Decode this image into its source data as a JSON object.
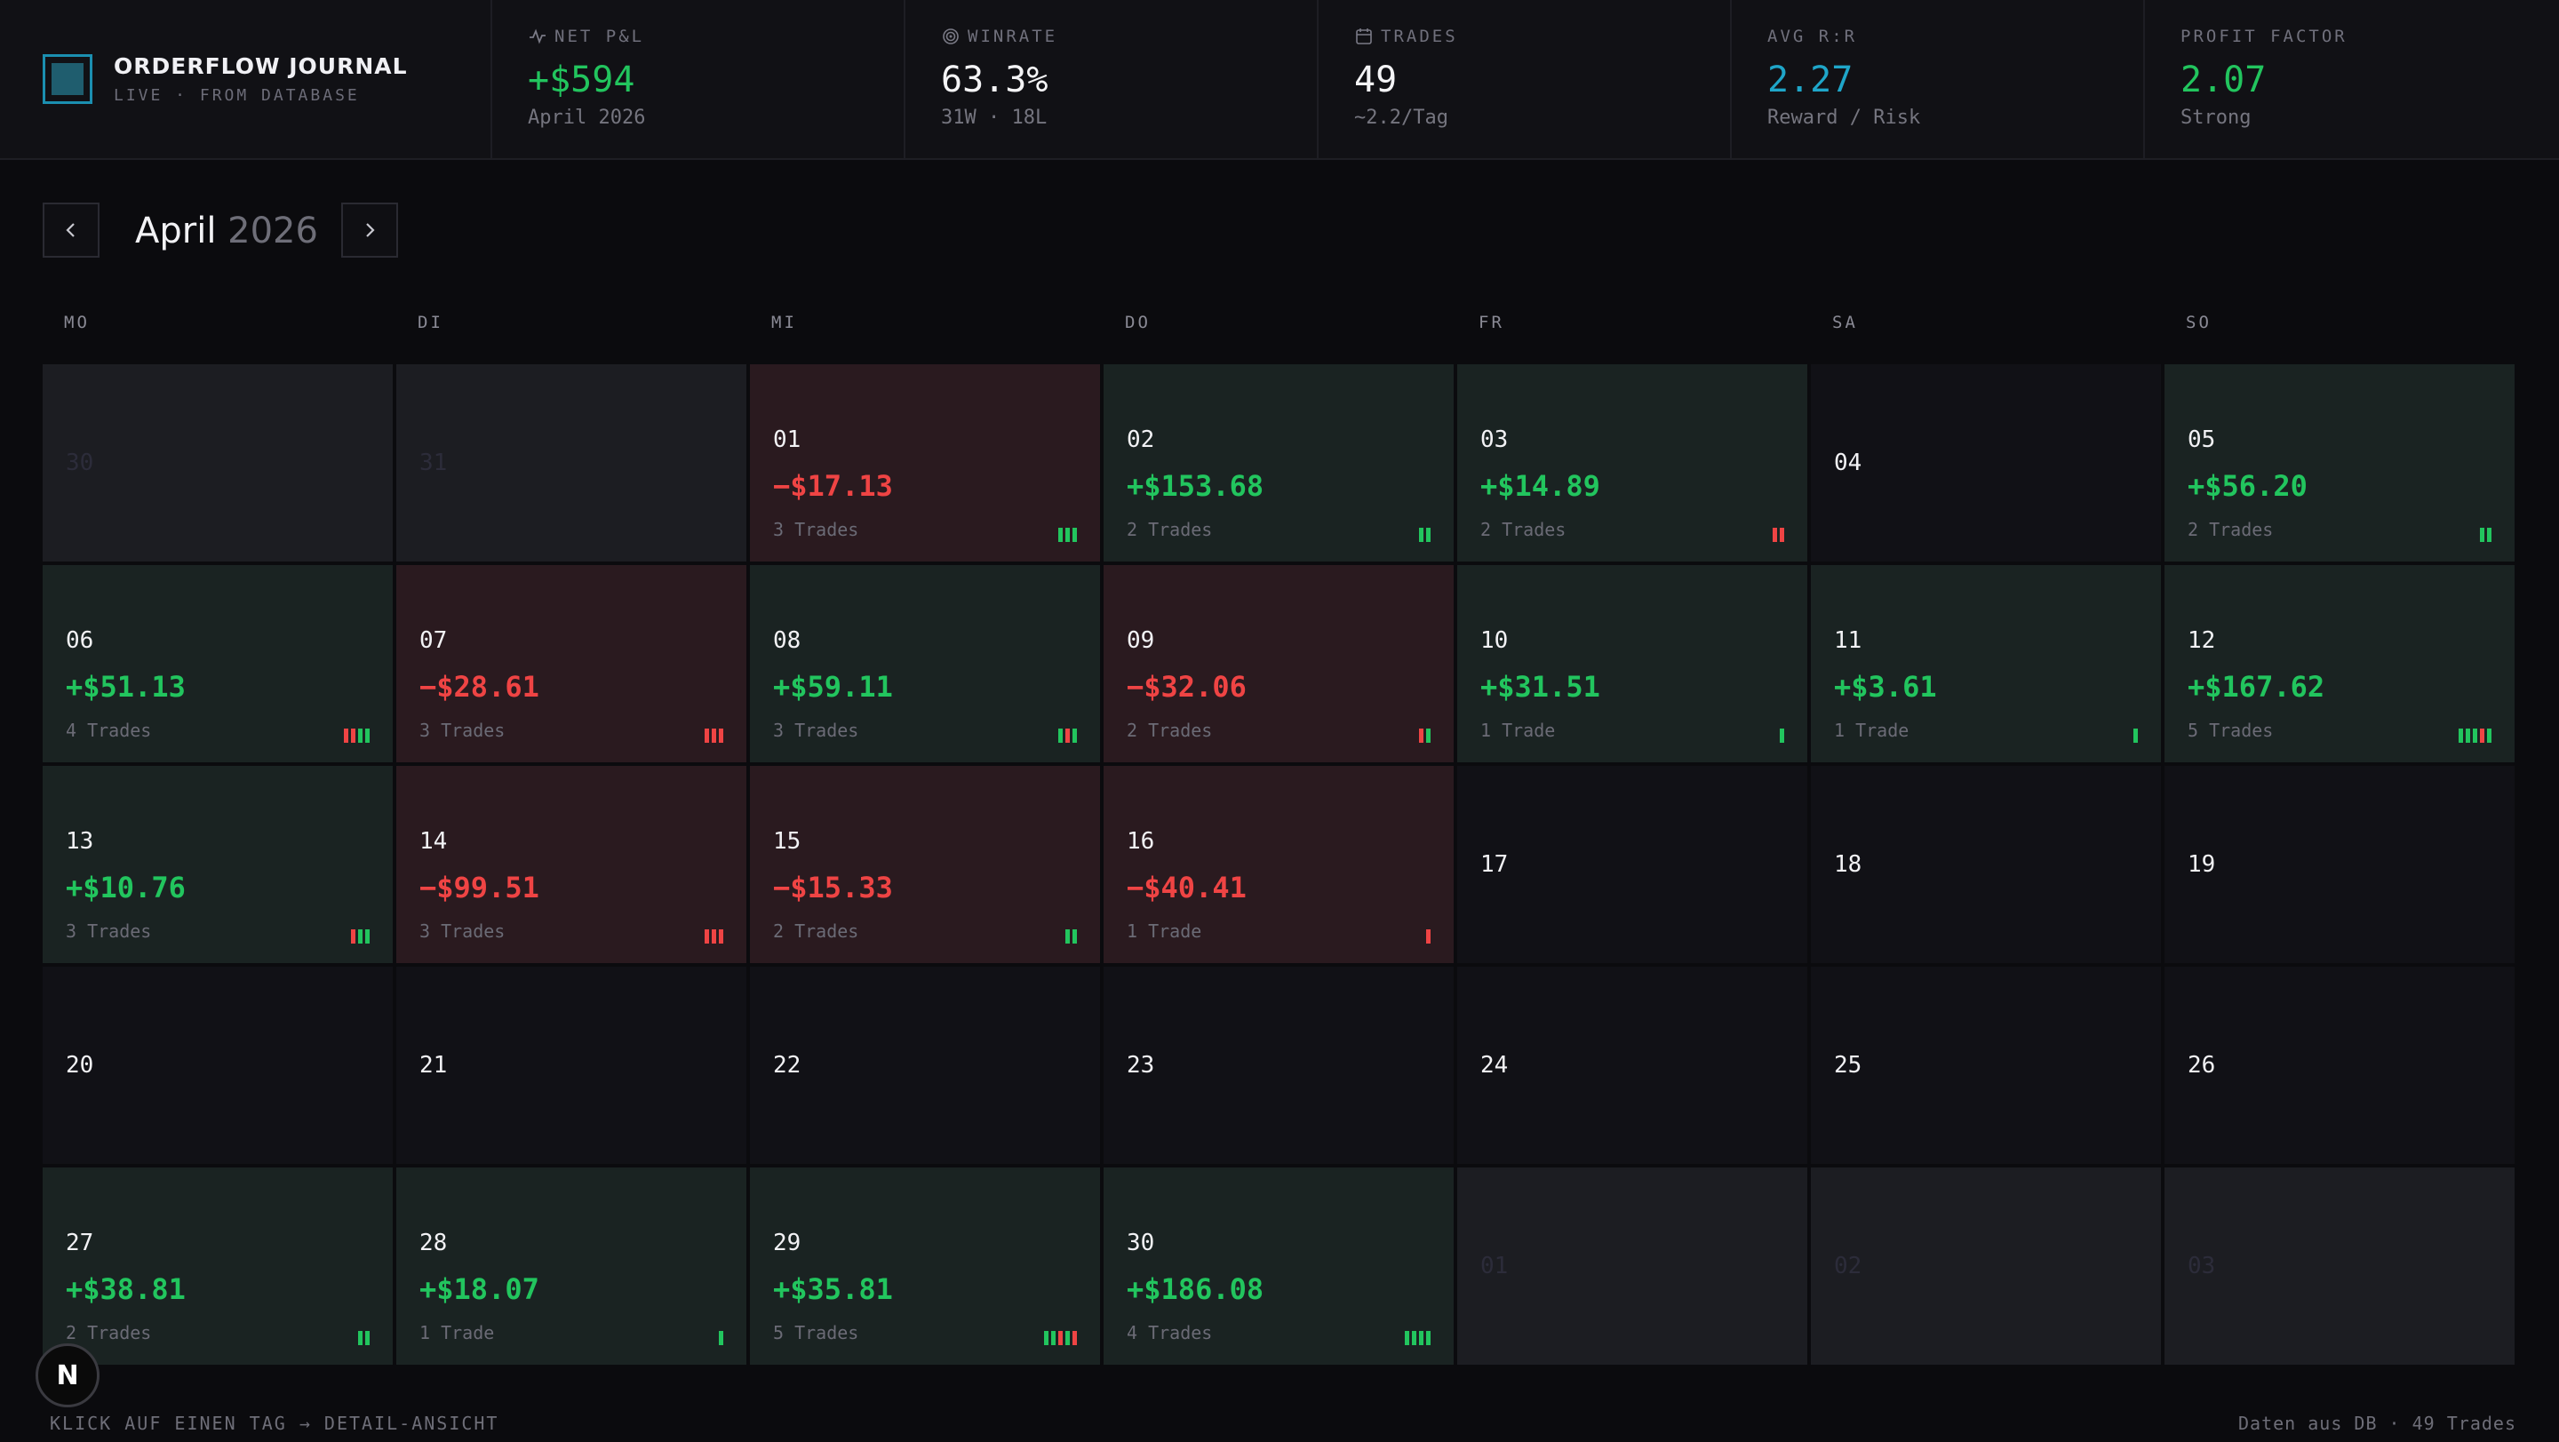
{
  "brand": {
    "title": "ORDERFLOW JOURNAL",
    "subtitle": "LIVE · FROM DATABASE"
  },
  "stats": [
    {
      "label": "NET P&L",
      "value": "+$594",
      "sub": "April 2026",
      "icon": "pulse-icon",
      "color": "#22c55e"
    },
    {
      "label": "WINRATE",
      "value": "63.3%",
      "sub": "31W · 18L",
      "icon": "target-icon",
      "color": "#f4f4f6"
    },
    {
      "label": "TRADES",
      "value": "49",
      "sub": "~2.2/Tag",
      "icon": "calendar-icon",
      "color": "#f4f4f6"
    },
    {
      "label": "AVG R:R",
      "value": "2.27",
      "sub": "Reward / Risk",
      "icon": "",
      "color": "#1fa6c9"
    },
    {
      "label": "PROFIT FACTOR",
      "value": "2.07",
      "sub": "Strong",
      "icon": "",
      "color": "#22c55e"
    }
  ],
  "month": {
    "name": "April",
    "year": "2026",
    "prev_icon": "chevron-left-icon",
    "next_icon": "chevron-right-icon"
  },
  "weekdays": [
    "MO",
    "DI",
    "MI",
    "DO",
    "FR",
    "SA",
    "SO"
  ],
  "days": [
    {
      "day": "30",
      "kind": "outside"
    },
    {
      "day": "31",
      "kind": "outside"
    },
    {
      "day": "01",
      "pnl": "−$17.13",
      "trades": "3 Trades",
      "kind": "loss",
      "bars": "www"
    },
    {
      "day": "02",
      "pnl": "+$153.68",
      "trades": "2 Trades",
      "kind": "win",
      "bars": "ww"
    },
    {
      "day": "03",
      "pnl": "+$14.89",
      "trades": "2 Trades",
      "kind": "win",
      "bars": "ll"
    },
    {
      "day": "04",
      "kind": "empty"
    },
    {
      "day": "05",
      "pnl": "+$56.20",
      "trades": "2 Trades",
      "kind": "win",
      "bars": "ww"
    },
    {
      "day": "06",
      "pnl": "+$51.13",
      "trades": "4 Trades",
      "kind": "win",
      "bars": "llww"
    },
    {
      "day": "07",
      "pnl": "−$28.61",
      "trades": "3 Trades",
      "kind": "loss",
      "bars": "lll"
    },
    {
      "day": "08",
      "pnl": "+$59.11",
      "trades": "3 Trades",
      "kind": "win",
      "bars": "wlw"
    },
    {
      "day": "09",
      "pnl": "−$32.06",
      "trades": "2 Trades",
      "kind": "loss",
      "bars": "lw"
    },
    {
      "day": "10",
      "pnl": "+$31.51",
      "trades": "1 Trade",
      "kind": "win",
      "bars": "w"
    },
    {
      "day": "11",
      "pnl": "+$3.61",
      "trades": "1 Trade",
      "kind": "win",
      "bars": "w"
    },
    {
      "day": "12",
      "pnl": "+$167.62",
      "trades": "5 Trades",
      "kind": "win",
      "bars": "wwwlw"
    },
    {
      "day": "13",
      "pnl": "+$10.76",
      "trades": "3 Trades",
      "kind": "win",
      "bars": "lww"
    },
    {
      "day": "14",
      "pnl": "−$99.51",
      "trades": "3 Trades",
      "kind": "loss",
      "bars": "lll"
    },
    {
      "day": "15",
      "pnl": "−$15.33",
      "trades": "2 Trades",
      "kind": "loss",
      "bars": "ww"
    },
    {
      "day": "16",
      "pnl": "−$40.41",
      "trades": "1 Trade",
      "kind": "loss",
      "bars": "l"
    },
    {
      "day": "17",
      "kind": "empty"
    },
    {
      "day": "18",
      "kind": "empty"
    },
    {
      "day": "19",
      "kind": "empty"
    },
    {
      "day": "20",
      "kind": "empty"
    },
    {
      "day": "21",
      "kind": "empty"
    },
    {
      "day": "22",
      "kind": "empty"
    },
    {
      "day": "23",
      "kind": "empty"
    },
    {
      "day": "24",
      "kind": "empty"
    },
    {
      "day": "25",
      "kind": "empty"
    },
    {
      "day": "26",
      "kind": "empty"
    },
    {
      "day": "27",
      "pnl": "+$38.81",
      "trades": "2 Trades",
      "kind": "win",
      "bars": "ww"
    },
    {
      "day": "28",
      "pnl": "+$18.07",
      "trades": "1 Trade",
      "kind": "win",
      "bars": "w"
    },
    {
      "day": "29",
      "pnl": "+$35.81",
      "trades": "5 Trades",
      "kind": "win",
      "bars": "wwlwl"
    },
    {
      "day": "30",
      "pnl": "+$186.08",
      "trades": "4 Trades",
      "kind": "win",
      "bars": "wwww"
    },
    {
      "day": "01",
      "kind": "outside"
    },
    {
      "day": "02",
      "kind": "outside"
    },
    {
      "day": "03",
      "kind": "outside"
    }
  ],
  "footer": {
    "hint": "KLICK AUF EINEN TAG → DETAIL-ANSICHT",
    "source": "Daten aus DB · 49 Trades",
    "badge": "N"
  }
}
